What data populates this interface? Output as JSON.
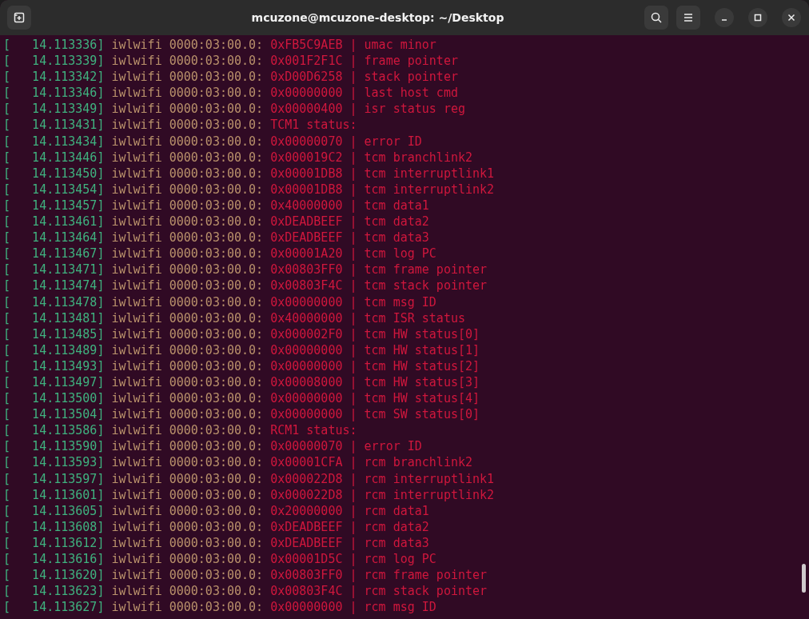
{
  "window": {
    "title": "mcuzone@mcuzone-desktop: ~/Desktop"
  },
  "lines": [
    {
      "timestamp": "[   14.113336]",
      "source": "iwlwifi 0000:03:00.0:",
      "message": "0xFB5C9AEB | umac minor"
    },
    {
      "timestamp": "[   14.113339]",
      "source": "iwlwifi 0000:03:00.0:",
      "message": "0x001F2F1C | frame pointer"
    },
    {
      "timestamp": "[   14.113342]",
      "source": "iwlwifi 0000:03:00.0:",
      "message": "0xD00D6258 | stack pointer"
    },
    {
      "timestamp": "[   14.113346]",
      "source": "iwlwifi 0000:03:00.0:",
      "message": "0x00000000 | last host cmd"
    },
    {
      "timestamp": "[   14.113349]",
      "source": "iwlwifi 0000:03:00.0:",
      "message": "0x00000400 | isr status reg"
    },
    {
      "timestamp": "[   14.113431]",
      "source": "iwlwifi 0000:03:00.0:",
      "message": "TCM1 status:"
    },
    {
      "timestamp": "[   14.113434]",
      "source": "iwlwifi 0000:03:00.0:",
      "message": "0x00000070 | error ID"
    },
    {
      "timestamp": "[   14.113446]",
      "source": "iwlwifi 0000:03:00.0:",
      "message": "0x000019C2 | tcm branchlink2"
    },
    {
      "timestamp": "[   14.113450]",
      "source": "iwlwifi 0000:03:00.0:",
      "message": "0x00001DB8 | tcm interruptlink1"
    },
    {
      "timestamp": "[   14.113454]",
      "source": "iwlwifi 0000:03:00.0:",
      "message": "0x00001DB8 | tcm interruptlink2"
    },
    {
      "timestamp": "[   14.113457]",
      "source": "iwlwifi 0000:03:00.0:",
      "message": "0x40000000 | tcm data1"
    },
    {
      "timestamp": "[   14.113461]",
      "source": "iwlwifi 0000:03:00.0:",
      "message": "0xDEADBEEF | tcm data2"
    },
    {
      "timestamp": "[   14.113464]",
      "source": "iwlwifi 0000:03:00.0:",
      "message": "0xDEADBEEF | tcm data3"
    },
    {
      "timestamp": "[   14.113467]",
      "source": "iwlwifi 0000:03:00.0:",
      "message": "0x00001A20 | tcm log PC"
    },
    {
      "timestamp": "[   14.113471]",
      "source": "iwlwifi 0000:03:00.0:",
      "message": "0x00803FF0 | tcm frame pointer"
    },
    {
      "timestamp": "[   14.113474]",
      "source": "iwlwifi 0000:03:00.0:",
      "message": "0x00803F4C | tcm stack pointer"
    },
    {
      "timestamp": "[   14.113478]",
      "source": "iwlwifi 0000:03:00.0:",
      "message": "0x00000000 | tcm msg ID"
    },
    {
      "timestamp": "[   14.113481]",
      "source": "iwlwifi 0000:03:00.0:",
      "message": "0x40000000 | tcm ISR status"
    },
    {
      "timestamp": "[   14.113485]",
      "source": "iwlwifi 0000:03:00.0:",
      "message": "0x000002F0 | tcm HW status[0]"
    },
    {
      "timestamp": "[   14.113489]",
      "source": "iwlwifi 0000:03:00.0:",
      "message": "0x00000000 | tcm HW status[1]"
    },
    {
      "timestamp": "[   14.113493]",
      "source": "iwlwifi 0000:03:00.0:",
      "message": "0x00000000 | tcm HW status[2]"
    },
    {
      "timestamp": "[   14.113497]",
      "source": "iwlwifi 0000:03:00.0:",
      "message": "0x00008000 | tcm HW status[3]"
    },
    {
      "timestamp": "[   14.113500]",
      "source": "iwlwifi 0000:03:00.0:",
      "message": "0x00000000 | tcm HW status[4]"
    },
    {
      "timestamp": "[   14.113504]",
      "source": "iwlwifi 0000:03:00.0:",
      "message": "0x00000000 | tcm SW status[0]"
    },
    {
      "timestamp": "[   14.113586]",
      "source": "iwlwifi 0000:03:00.0:",
      "message": "RCM1 status:"
    },
    {
      "timestamp": "[   14.113590]",
      "source": "iwlwifi 0000:03:00.0:",
      "message": "0x00000070 | error ID"
    },
    {
      "timestamp": "[   14.113593]",
      "source": "iwlwifi 0000:03:00.0:",
      "message": "0x00001CFA | rcm branchlink2"
    },
    {
      "timestamp": "[   14.113597]",
      "source": "iwlwifi 0000:03:00.0:",
      "message": "0x000022D8 | rcm interruptlink1"
    },
    {
      "timestamp": "[   14.113601]",
      "source": "iwlwifi 0000:03:00.0:",
      "message": "0x000022D8 | rcm interruptlink2"
    },
    {
      "timestamp": "[   14.113605]",
      "source": "iwlwifi 0000:03:00.0:",
      "message": "0x20000000 | rcm data1"
    },
    {
      "timestamp": "[   14.113608]",
      "source": "iwlwifi 0000:03:00.0:",
      "message": "0xDEADBEEF | rcm data2"
    },
    {
      "timestamp": "[   14.113612]",
      "source": "iwlwifi 0000:03:00.0:",
      "message": "0xDEADBEEF | rcm data3"
    },
    {
      "timestamp": "[   14.113616]",
      "source": "iwlwifi 0000:03:00.0:",
      "message": "0x00001D5C | rcm log PC"
    },
    {
      "timestamp": "[   14.113620]",
      "source": "iwlwifi 0000:03:00.0:",
      "message": "0x00803FF0 | rcm frame pointer"
    },
    {
      "timestamp": "[   14.113623]",
      "source": "iwlwifi 0000:03:00.0:",
      "message": "0x00803F4C | rcm stack pointer"
    },
    {
      "timestamp": "[   14.113627]",
      "source": "iwlwifi 0000:03:00.0:",
      "message": "0x00000000 | rcm msg ID"
    }
  ]
}
